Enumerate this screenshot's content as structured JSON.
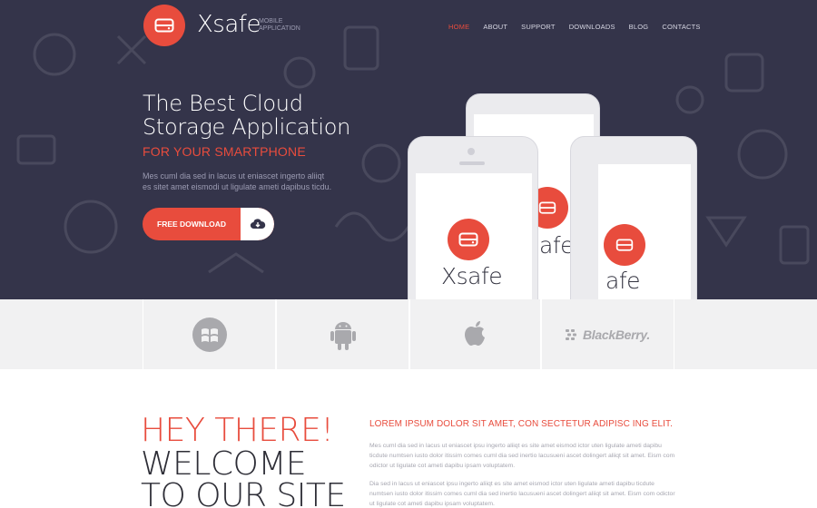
{
  "brand": {
    "name": "Xsafe",
    "tagline_line1": "MOBILE",
    "tagline_line2": "APPLICATION",
    "accent": "#e84c3d",
    "hero_bg": "#34344a"
  },
  "nav": {
    "items": [
      {
        "label": "HOME",
        "active": true
      },
      {
        "label": "ABOUT",
        "active": false
      },
      {
        "label": "SUPPORT",
        "active": false
      },
      {
        "label": "DOWNLOADS",
        "active": false
      },
      {
        "label": "BLOG",
        "active": false
      },
      {
        "label": "CONTACTS",
        "active": false
      }
    ]
  },
  "hero": {
    "title_line1": "The Best Cloud",
    "title_line2": "Storage Application",
    "subtitle": "FOR YOUR SMARTPHONE",
    "text_line1": "Mes cuml dia sed in lacus ut eniascet ingerto aliiqt",
    "text_line2": "es sitet amet eismodi ut ligulate ameti dapibus ticdu.",
    "button_label": "FREE DOWNLOAD",
    "button_icon": "cloud-download-icon"
  },
  "phones": {
    "app_name": "Xsafe",
    "partial_name": "afe"
  },
  "platforms": {
    "items": [
      {
        "name": "windows",
        "icon": "windows-icon"
      },
      {
        "name": "android",
        "icon": "android-icon"
      },
      {
        "name": "apple",
        "icon": "apple-icon"
      },
      {
        "name": "blackberry",
        "icon": "blackberry-icon",
        "label": "BlackBerry."
      }
    ]
  },
  "welcome": {
    "line1": "HEY THERE!",
    "line2": "WELCOME",
    "line3": "TO OUR SITE",
    "heading": "LOREM IPSUM DOLOR SIT AMET, CON SECTETUR ADIPISC ING ELIT.",
    "para1": "Mes cuml dia sed in lacus ut eniascet ipsu ingerto aliiqt es site amet eismod ictor uten ligulate ameti dapibu ticdute numtsen iusto dolor itissim comes cuml dia sed inertio lacusueni ascet dolingert aliiqt sit amet. Eism com odictor ut ligulate cot ameti dapibu ipsam voluptatem.",
    "para2": "Dia sed in lacus ut eniascet ipsu ingerto aliiqt es site amet eismod ictor uten ligulate ameti dapibu ticdute numtsen iusto dolor itissim comes cuml dia sed inertio lacusueni ascet dolingert aliiqt sit amet. Eism com odictor ut ligulate cot ameti dapibu ipsam voluptatem."
  }
}
